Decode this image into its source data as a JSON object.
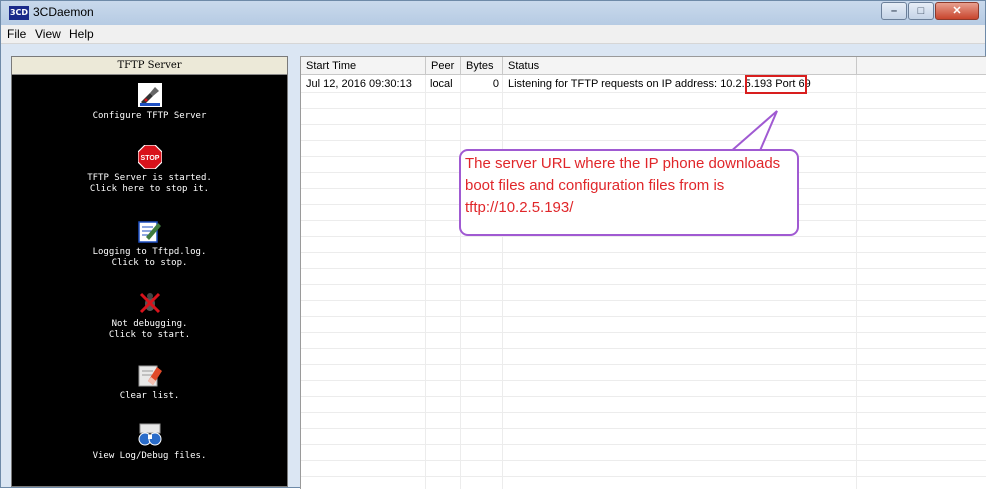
{
  "window": {
    "title": "3CDaemon",
    "app_icon_text": "3CD"
  },
  "menu": {
    "items": [
      "File",
      "View",
      "Help"
    ]
  },
  "left_panel": {
    "header": "TFTP Server",
    "actions": [
      {
        "icon": "configure-icon",
        "lines": [
          "Configure TFTP Server"
        ]
      },
      {
        "icon": "stop-sign-icon",
        "lines": [
          "TFTP Server is started.",
          "Click here to stop it."
        ],
        "icon_text": "STOP"
      },
      {
        "icon": "log-pencil-icon",
        "lines": [
          "Logging to Tftpd.log.",
          "Click to stop."
        ]
      },
      {
        "icon": "bug-icon",
        "lines": [
          "Not debugging.",
          "Click to start."
        ]
      },
      {
        "icon": "eraser-icon",
        "lines": [
          "Clear list."
        ]
      },
      {
        "icon": "binoculars-icon",
        "lines": [
          "View Log/Debug files."
        ]
      }
    ]
  },
  "table": {
    "columns": [
      "Start Time",
      "Peer",
      "Bytes",
      "Status"
    ],
    "rows": [
      {
        "start_time": "Jul 12, 2016 09:30:13",
        "peer": "local",
        "bytes": "0",
        "status_prefix": "Listening for TFTP requests on IP address:",
        "ip": "10.2.5.193",
        "status_suffix": "Port 69"
      }
    ]
  },
  "callout": {
    "text": "The server URL where the IP phone downloads boot files and configuration files from is tftp://10.2.5.193/",
    "border_color": "#a05ad2",
    "text_color": "#e0262a"
  },
  "colors": {
    "highlight_box": "#d81e1e",
    "panel_bg": "#000000"
  }
}
